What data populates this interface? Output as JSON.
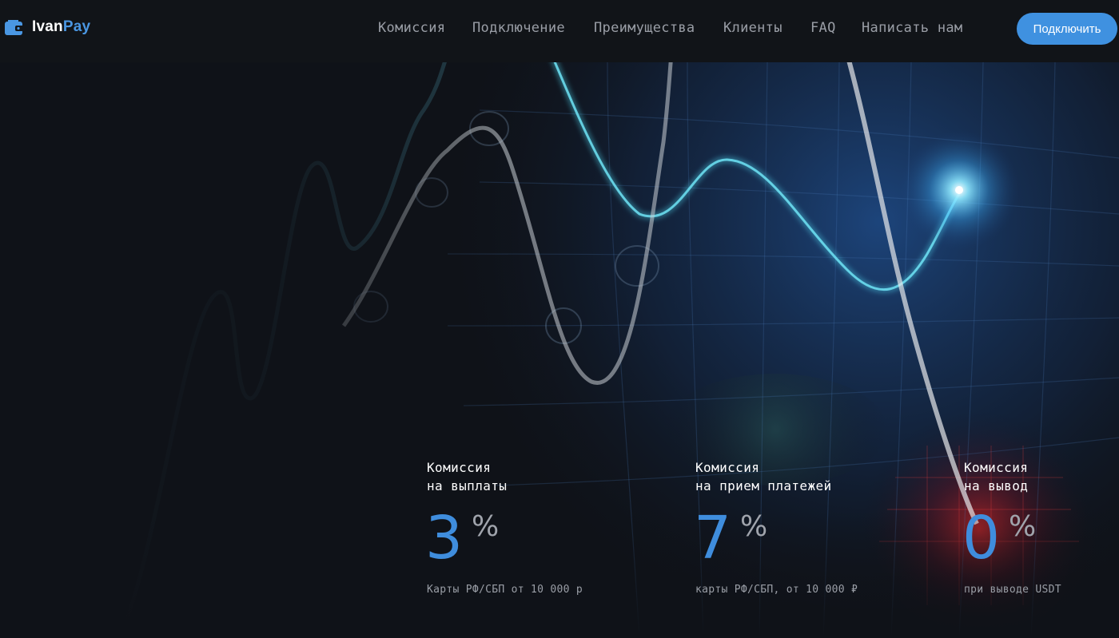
{
  "brand": {
    "name_part1": "Ivan",
    "name_part2": "Pay",
    "icon": "wallet-icon",
    "accent_color": "#4a97e3"
  },
  "nav": {
    "items": [
      {
        "label": "Комиссия"
      },
      {
        "label": "Подключение"
      },
      {
        "label": "Преимущества"
      },
      {
        "label": "Клиенты"
      },
      {
        "label": "FAQ"
      },
      {
        "label": "Написать нам"
      }
    ],
    "cta_label": "Подключить"
  },
  "stats": [
    {
      "label_line1": "Комиссия",
      "label_line2": "на выплаты",
      "value": "3",
      "unit": "%",
      "note": "Карты РФ/СБП от 10 000 р"
    },
    {
      "label_line1": "Комиссия",
      "label_line2": "на прием платежей",
      "value": "7",
      "unit": "%",
      "note": "карты РФ/СБП, от 10 000 ₽"
    },
    {
      "label_line1": "Комиссия",
      "label_line2": "на вывод",
      "value": "0",
      "unit": "%",
      "note": "при выводе USDT"
    }
  ],
  "colors": {
    "background": "#0f1218",
    "header": "#111418",
    "accent": "#3f91e0",
    "line_glow": "#4fd8f0",
    "muted_text": "#9a9ea6"
  }
}
